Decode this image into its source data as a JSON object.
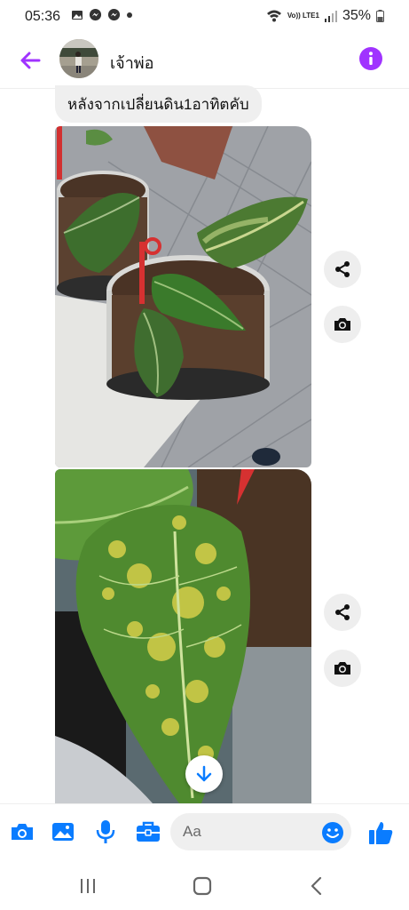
{
  "status_bar": {
    "time": "05:36",
    "network_label": "Vo)) LTE1",
    "battery": "35%"
  },
  "header": {
    "contact_name": "เจ้าพ่อ",
    "back_icon": "arrow-left-icon",
    "info_icon": "info-icon"
  },
  "messages": [
    {
      "type": "text",
      "text": "หลังจากเปลี่ยนดิน1อาทิตคับ"
    },
    {
      "type": "photo",
      "subject": "plants-in-pots"
    },
    {
      "type": "photo",
      "subject": "variegated-leaf-closeup"
    }
  ],
  "side_actions": {
    "share_icon": "share-icon",
    "camera_icon": "camera-icon"
  },
  "composer": {
    "placeholder": "Aa",
    "icons": [
      "camera-icon",
      "gallery-icon",
      "microphone-icon",
      "briefcase-icon",
      "emoji-icon",
      "like-icon"
    ]
  },
  "colors": {
    "accent_purple": "#a033ff",
    "messenger_blue": "#0a7cff",
    "bubble_gray": "#efefef"
  }
}
